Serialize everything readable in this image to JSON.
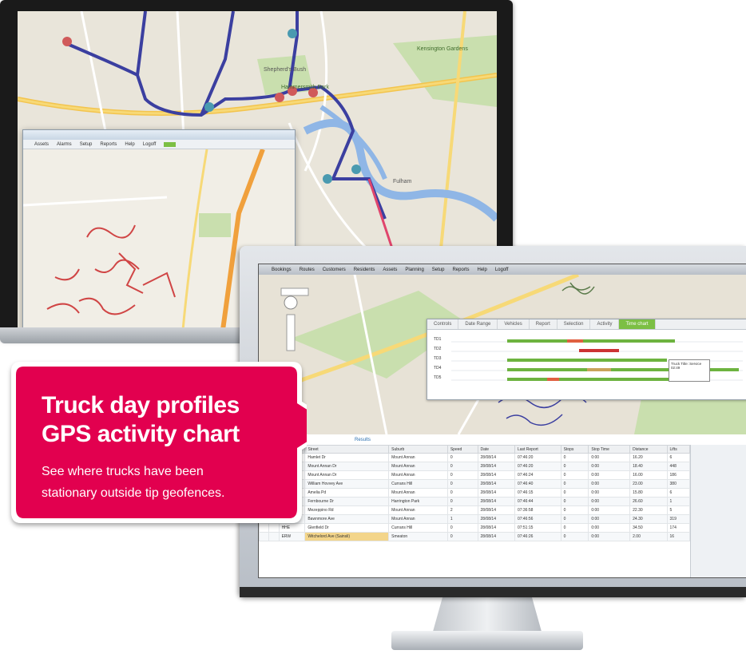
{
  "colors": {
    "accent": "#e2004f",
    "menu_highlight": "#7cbf44",
    "route": "#3b3fa0"
  },
  "callout": {
    "title_line1": "Truck day profiles",
    "title_line2": "GPS activity chart",
    "body_line1": "See where trucks have been",
    "body_line2": "stationary outside tip geofences."
  },
  "back_app": {
    "menu": [
      "Assets",
      "Alarms",
      "Setup",
      "Reports",
      "Help",
      "Logoff"
    ],
    "map_labels": [
      "Shepherd's Bush",
      "Kensington Gardens",
      "Hammersmith Park",
      "Fulham"
    ]
  },
  "front_app": {
    "menu": [
      "Bookings",
      "Routes",
      "Customers",
      "Residents",
      "Assets",
      "Planning",
      "Setup",
      "Reports",
      "Help",
      "Logoff"
    ],
    "chart_tabs": [
      "Controls",
      "Date Range",
      "Vehicles",
      "Report",
      "Selection",
      "Activity",
      "Time chart"
    ],
    "chart_rows": [
      "TD1",
      "TD2",
      "TD3",
      "TD4",
      "TD5"
    ],
    "tooltip": "Truck Title: Service 02:49",
    "results_tab": "Results",
    "table": {
      "headers": [
        "",
        "",
        "",
        "Street",
        "Suburb",
        "Speed",
        "Date",
        "Last Report",
        "Stops",
        "Stop Time",
        "Distance",
        "Lifts"
      ],
      "rows": [
        [
          "",
          "",
          "Stirry",
          "Hamlet Dr",
          "Mount Annan",
          "0",
          "28/08/14",
          "07:46:20",
          "0",
          "0:00",
          "16.20",
          "6"
        ],
        [
          "",
          "",
          "HE",
          "Mount Annan Dr",
          "Mount Annan",
          "0",
          "28/08/14",
          "07:46:20",
          "0",
          "0:00",
          "18.40",
          "448"
        ],
        [
          "",
          "",
          "Stirry",
          "Mount Annan Dr",
          "Mount Annan",
          "0",
          "28/08/14",
          "07:46:24",
          "0",
          "0:00",
          "16.00",
          "186"
        ],
        [
          "",
          "",
          "ERW",
          "William Hovvey Ave",
          "Currans Hill",
          "0",
          "28/08/14",
          "07:46:40",
          "0",
          "0:00",
          "23.00",
          "380"
        ],
        [
          "",
          "",
          "Stirry",
          "Amelia Pd",
          "Mount Annan",
          "0",
          "28/08/14",
          "07:46:15",
          "0",
          "0:00",
          "15.80",
          "6"
        ],
        [
          "",
          "",
          "Wm",
          "Fernbourne Dr",
          "Harrington Park",
          "0",
          "28/08/14",
          "07:46:44",
          "0",
          "0:00",
          "26.60",
          "1"
        ],
        [
          "",
          "",
          "Eden",
          "Mezeppino Rd",
          "Mount Annan",
          "2",
          "28/08/14",
          "07:36:58",
          "0",
          "0:00",
          "22.30",
          "5"
        ],
        [
          "",
          "",
          "Stirry",
          "Bawnmore Ave",
          "Mount Annan",
          "1",
          "28/08/14",
          "07:46:56",
          "0",
          "0:00",
          "24.30",
          "319"
        ],
        [
          "",
          "",
          "HHE",
          "Glenfield Dr",
          "Currans Hill",
          "0",
          "28/08/14",
          "07:51:15",
          "0",
          "0:00",
          "34.50",
          "174"
        ],
        [
          "",
          "",
          "ERW",
          "Witchelord Ave (Sainsli)",
          "Smeaton",
          "0",
          "28/08/14",
          "07:46:26",
          "0",
          "0:00",
          "2.00",
          "16"
        ]
      ]
    }
  }
}
